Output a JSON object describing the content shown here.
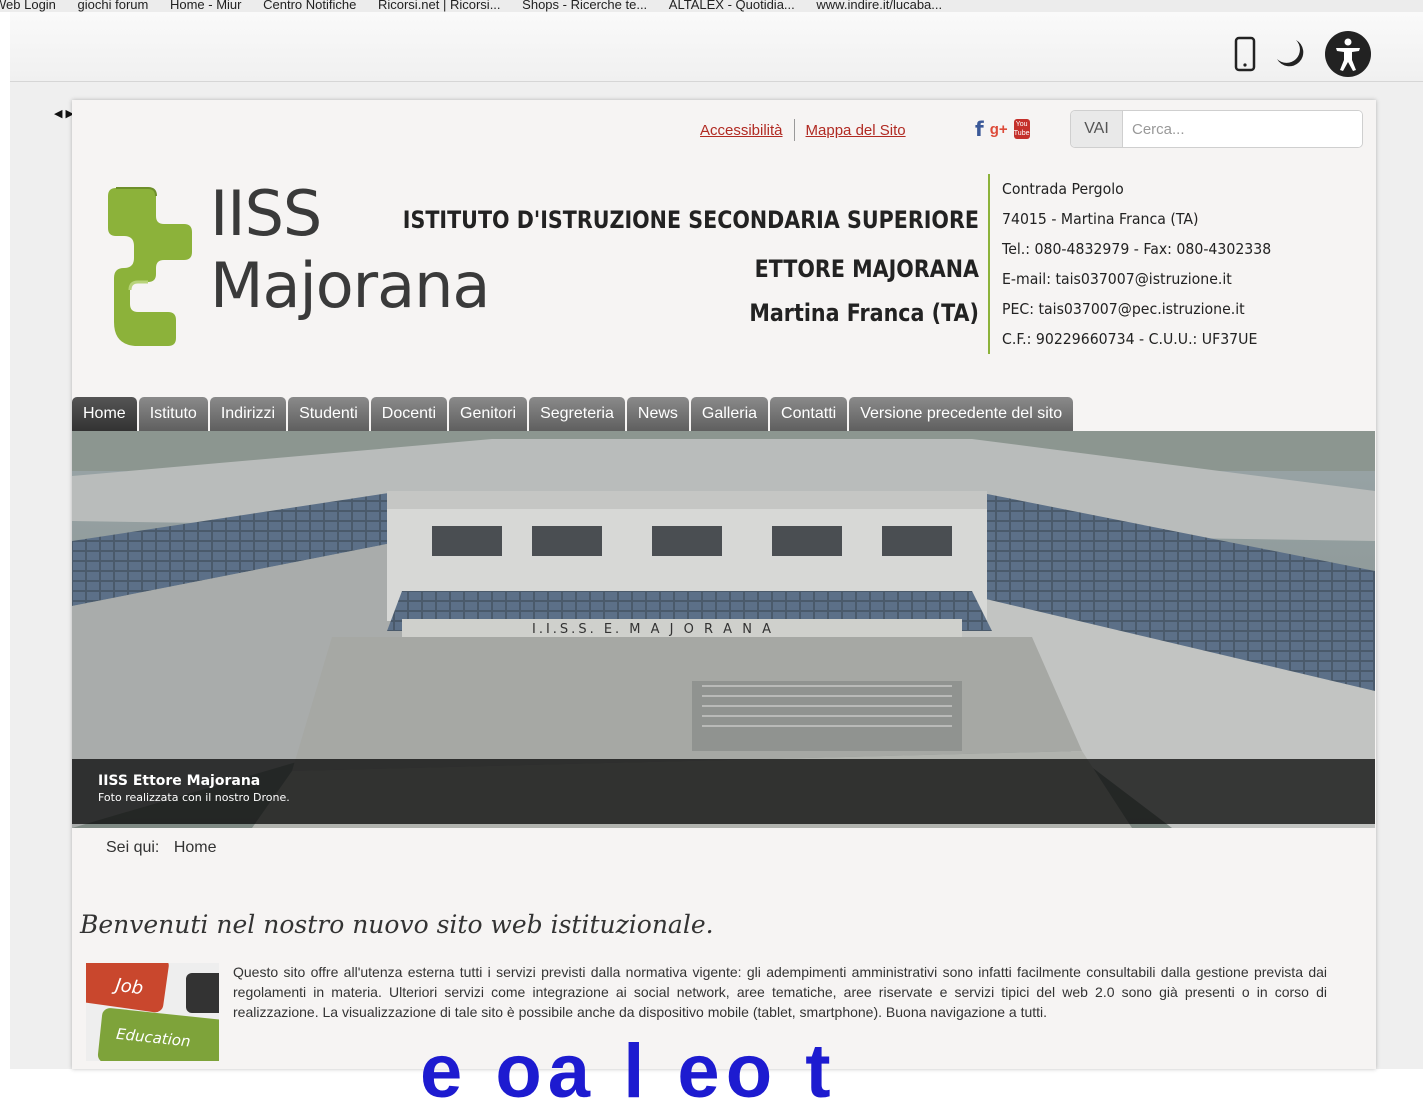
{
  "browser": {
    "bookmarks": [
      "Web Login",
      "giochi forum",
      "Home - Miur",
      "Centro Notifiche",
      "Ricorsi.net | Ricorsi...",
      "Shops - Ricerche te...",
      "ALTALEX - Quotidia...",
      "www.indire.it/lucaba..."
    ]
  },
  "header": {
    "accessibility_link": "Accessibilità",
    "sitemap_link": "Mappa del Sito",
    "search_button": "VAI",
    "search_placeholder": "Cerca...",
    "logo_line1": "IISS",
    "logo_line2": "Majorana",
    "school_line1": "ISTITUTO D'ISTRUZIONE SECONDARIA SUPERIORE",
    "school_line2": "ETTORE MAJORANA",
    "school_line3": "Martina Franca (TA)",
    "contact": [
      "Contrada Pergolo",
      "74015 - Martina Franca (TA)",
      "Tel.: 080-4832979 - Fax: 080-4302338",
      "E-mail: tais037007@istruzione.it",
      "PEC: tais037007@pec.istruzione.it",
      "C.F.: 90229660734 - C.U.U.: UF37UE"
    ],
    "accent_color": "#8cb23a"
  },
  "nav": {
    "tabs": [
      "Home",
      "Istituto",
      "Indirizzi",
      "Studenti",
      "Docenti",
      "Genitori",
      "Segreteria",
      "News",
      "Galleria",
      "Contatti",
      "Versione precedente del sito"
    ],
    "active": "Home"
  },
  "banner": {
    "building_sign": "I.I.S.S.   E. M A J O R A N A",
    "caption_title": "IISS Ettore Majorana",
    "caption_sub": "Foto realizzata con il nostro Drone."
  },
  "breadcrumb": {
    "label": "Sei qui:",
    "current": "Home"
  },
  "main": {
    "welcome": "Benvenuti nel nostro nuovo sito web istituzionale.",
    "thumb_word1": "Job",
    "thumb_word2": "Education",
    "intro": "Questo sito offre all'utenza esterna tutti i servizi previsti dalla normativa vigente: gli adempimenti amministrativi sono infatti facilmente consultabili dalla gestione prevista dai regolamenti in materia. Ulteriori servizi come integrazione ai social network, aree tematiche, aree riservate e servizi tipici del web 2.0 sono già presenti o in corso di realizzazione. La visualizzazione di tale sito è possibile anche da dispositivo mobile (tablet, smartphone). Buona navigazione a tutti.",
    "overlay_text": "e  oa  l  eo  t"
  }
}
